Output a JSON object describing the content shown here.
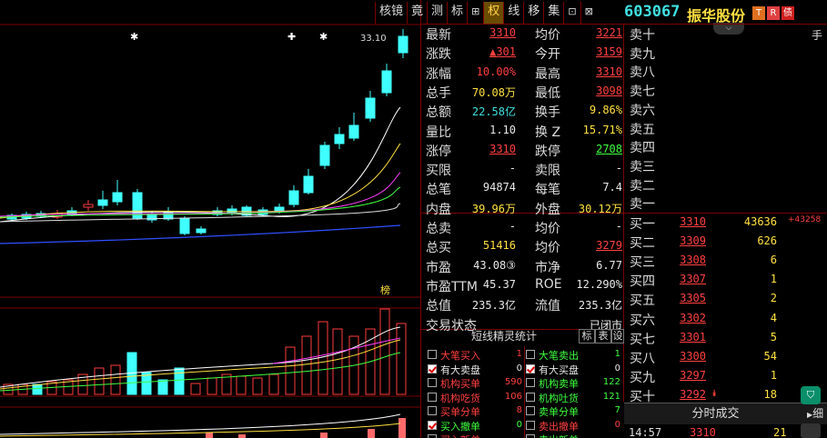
{
  "toolbar": {
    "items": [
      "核镜",
      "竟",
      "测",
      "标",
      "⊞",
      "权",
      "线",
      "移",
      "集",
      "⊡",
      "⊠"
    ]
  },
  "header": {
    "code": "603067",
    "name": "振华股份",
    "tag_t": "T",
    "tag_r": "R",
    "tag_d": "债",
    "shou": "手"
  },
  "chart": {
    "top_price_label": "33.10",
    "bang_label": "榜",
    "star_marks": [
      "✱",
      "✚",
      "✱"
    ]
  },
  "chart_data": {
    "type": "candlestick",
    "candles": [
      {
        "o": -1,
        "c": -1,
        "h": -1,
        "l": -1
      }
    ],
    "price_range": [
      0,
      0
    ],
    "volumes": []
  },
  "quote": {
    "rows": [
      {
        "l1": "最新",
        "v1": "3310",
        "c1": "red",
        "l2": "均价",
        "v2": "3221",
        "c2": "red",
        "u1": true,
        "u2": true
      },
      {
        "l1": "涨跌",
        "v1": "▲301",
        "c1": "red",
        "l2": "今开",
        "v2": "3159",
        "c2": "red",
        "u1": true,
        "u2": true
      },
      {
        "l1": "涨幅",
        "v1": "10.00%",
        "c1": "red",
        "l2": "最高",
        "v2": "3310",
        "c2": "red",
        "u1": false,
        "u2": true
      },
      {
        "l1": "总手",
        "v1": "70.08万",
        "c1": "yel",
        "l2": "最低",
        "v2": "3098",
        "c2": "red",
        "u1": false,
        "u2": true
      },
      {
        "l1": "总额",
        "v1": "22.58亿",
        "c1": "cyan",
        "l2": "换手",
        "v2": "9.86%",
        "c2": "yel",
        "u1": false,
        "u2": false
      },
      {
        "l1": "量比",
        "v1": "1.10",
        "c1": "wht",
        "l2": "换 Z",
        "v2": "15.71%",
        "c2": "yel",
        "u1": false,
        "u2": false
      },
      {
        "l1": "涨停",
        "v1": "3310",
        "c1": "red",
        "l2": "跌停",
        "v2": "2708",
        "c2": "grn",
        "u1": true,
        "u2": true
      },
      {
        "l1": "买限",
        "v1": "-",
        "c1": "wht",
        "l2": "卖限",
        "v2": "-",
        "c2": "wht",
        "u1": false,
        "u2": false
      },
      {
        "l1": "总笔",
        "v1": "94874",
        "c1": "wht",
        "l2": "每笔",
        "v2": "7.4",
        "c2": "wht",
        "u1": false,
        "u2": false
      },
      {
        "l1": "内盘",
        "v1": "39.96万",
        "c1": "yel",
        "l2": "外盘",
        "v2": "30.12万",
        "c2": "yel",
        "u1": false,
        "u2": false
      },
      {
        "l1": "总卖",
        "v1": "-",
        "c1": "wht",
        "l2": "均价",
        "v2": "-",
        "c2": "wht",
        "u1": false,
        "u2": false
      },
      {
        "l1": "总买",
        "v1": "51416",
        "c1": "yel",
        "l2": "均价",
        "v2": "3279",
        "c2": "red",
        "u1": false,
        "u2": true
      },
      {
        "l1": "市盈",
        "v1": "43.08③",
        "c1": "wht",
        "l2": "市净",
        "v2": "6.77",
        "c2": "wht",
        "u1": false,
        "u2": false
      },
      {
        "l1": "市盈TTM",
        "v1": "45.37",
        "c1": "wht",
        "l2": "ROE",
        "v2": "12.290%",
        "c2": "wht",
        "u1": false,
        "u2": false
      },
      {
        "l1": "总值",
        "v1": "235.3亿",
        "c1": "wht",
        "l2": "流值",
        "v2": "235.3亿",
        "c2": "wht",
        "u1": false,
        "u2": false
      },
      {
        "l1": "交易状态",
        "v1": "",
        "c1": "wht",
        "l2": "",
        "v2": "已闭市",
        "c2": "wht",
        "u1": false,
        "u2": false
      }
    ]
  },
  "book": {
    "sells": [
      "卖十",
      "卖九",
      "卖八",
      "卖七",
      "卖六",
      "卖五",
      "卖四",
      "卖三",
      "卖二",
      "卖一"
    ],
    "buys": [
      {
        "label": "买一",
        "price": "3310",
        "vol": "43636",
        "chg": "+43258"
      },
      {
        "label": "买二",
        "price": "3309",
        "vol": "626",
        "chg": ""
      },
      {
        "label": "买三",
        "price": "3308",
        "vol": "6",
        "chg": ""
      },
      {
        "label": "买四",
        "price": "3307",
        "vol": "1",
        "chg": ""
      },
      {
        "label": "买五",
        "price": "3305",
        "vol": "2",
        "chg": ""
      },
      {
        "label": "买六",
        "price": "3302",
        "vol": "4",
        "chg": ""
      },
      {
        "label": "买七",
        "price": "3301",
        "vol": "5",
        "chg": ""
      },
      {
        "label": "买八",
        "price": "3300",
        "vol": "54",
        "chg": ""
      },
      {
        "label": "买九",
        "price": "3297",
        "vol": "1",
        "chg": ""
      },
      {
        "label": "买十",
        "price": "3292",
        "vol": "18",
        "chg": ""
      }
    ],
    "fenshi": "分时成交",
    "xi": "细",
    "last_time": "14:57",
    "last_price": "3310",
    "last_vol": "21"
  },
  "stat": {
    "title": "短线精灵统计",
    "btn1": "标",
    "btn2": "表",
    "btn3": "设",
    "left": [
      {
        "label": "大笔买入",
        "val": "1",
        "on": false,
        "color": "red"
      },
      {
        "label": "有大卖盘",
        "val": "0",
        "on": true,
        "color": "wht"
      },
      {
        "label": "机构买单",
        "val": "590",
        "on": false,
        "color": "red"
      },
      {
        "label": "机构吃货",
        "val": "106",
        "on": false,
        "color": "red"
      },
      {
        "label": "买单分单",
        "val": "8",
        "on": false,
        "color": "red"
      },
      {
        "label": "买入撤单",
        "val": "0",
        "on": true,
        "color": "grn"
      },
      {
        "label": "买入新单",
        "val": "",
        "on": false,
        "color": "red"
      }
    ],
    "right": [
      {
        "label": "大笔卖出",
        "val": "1",
        "on": false,
        "color": "grn"
      },
      {
        "label": "有大买盘",
        "val": "0",
        "on": true,
        "color": "wht"
      },
      {
        "label": "机构卖单",
        "val": "122",
        "on": false,
        "color": "grn"
      },
      {
        "label": "机构吐货",
        "val": "121",
        "on": false,
        "color": "grn"
      },
      {
        "label": "卖单分单",
        "val": "7",
        "on": false,
        "color": "grn"
      },
      {
        "label": "卖出撤单",
        "val": "0",
        "on": false,
        "color": "red"
      },
      {
        "label": "卖出新单",
        "val": "",
        "on": false,
        "color": "grn"
      }
    ]
  }
}
